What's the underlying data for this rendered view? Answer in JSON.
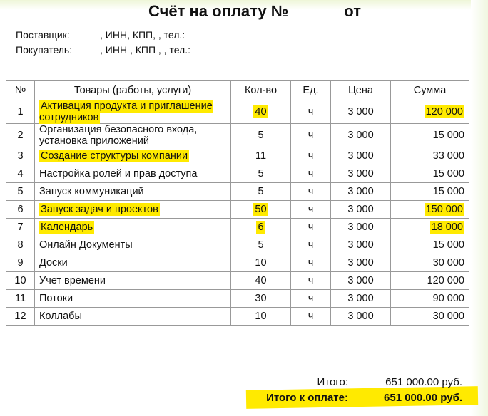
{
  "title": {
    "main": "Счёт на оплату №",
    "from": "от"
  },
  "supplier": {
    "label": "Поставщик:",
    "value": ", ИНН, КПП, , тел.:"
  },
  "buyer": {
    "label": "Покупатель:",
    "value": ", ИНН , КПП , , тел.:"
  },
  "table": {
    "headers": [
      "№",
      "Товары (работы, услуги)",
      "Кол-во",
      "Ед.",
      "Цена",
      "Сумма"
    ],
    "rows": [
      {
        "n": "1",
        "name": "Активация продукта и приглашение сотрудников",
        "qty": "40",
        "unit": "ч",
        "price": "3 000",
        "sum": "120 000",
        "hl": true
      },
      {
        "n": "2",
        "name": "Организация безопасного входа, установка приложений",
        "qty": "5",
        "unit": "ч",
        "price": "3 000",
        "sum": "15 000",
        "hl": false
      },
      {
        "n": "3",
        "name": "Создание структуры компании",
        "qty": "11",
        "unit": "ч",
        "price": "3 000",
        "sum": "33 000",
        "hl": "name"
      },
      {
        "n": "4",
        "name": "Настройка ролей и прав доступа",
        "qty": "5",
        "unit": "ч",
        "price": "3 000",
        "sum": "15 000",
        "hl": false
      },
      {
        "n": "5",
        "name": "Запуск коммуникаций",
        "qty": "5",
        "unit": "ч",
        "price": "3 000",
        "sum": "15 000",
        "hl": false
      },
      {
        "n": "6",
        "name": "Запуск задач и проектов",
        "qty": "50",
        "unit": "ч",
        "price": "3 000",
        "sum": "150 000",
        "hl": true
      },
      {
        "n": "7",
        "name": "Календарь",
        "qty": "6",
        "unit": "ч",
        "price": "3 000",
        "sum": "18 000",
        "hl": true
      },
      {
        "n": "8",
        "name": "Онлайн Документы",
        "qty": "5",
        "unit": "ч",
        "price": "3 000",
        "sum": "15 000",
        "hl": false
      },
      {
        "n": "9",
        "name": "Доски",
        "qty": "10",
        "unit": "ч",
        "price": "3 000",
        "sum": "30 000",
        "hl": false
      },
      {
        "n": "10",
        "name": "Учет времени",
        "qty": "40",
        "unit": "ч",
        "price": "3 000",
        "sum": "120 000",
        "hl": false
      },
      {
        "n": "11",
        "name": "Потоки",
        "qty": "30",
        "unit": "ч",
        "price": "3 000",
        "sum": "90 000",
        "hl": false
      },
      {
        "n": "12",
        "name": "Коллабы",
        "qty": "10",
        "unit": "ч",
        "price": "3 000",
        "sum": "30 000",
        "hl": false
      }
    ]
  },
  "totals": {
    "total_label": "Итого:",
    "total_value": "651 000.00 руб.",
    "due_label": "Итого к оплате:",
    "due_value": "651 000.00 руб."
  },
  "colors": {
    "highlight": "#ffea00"
  }
}
